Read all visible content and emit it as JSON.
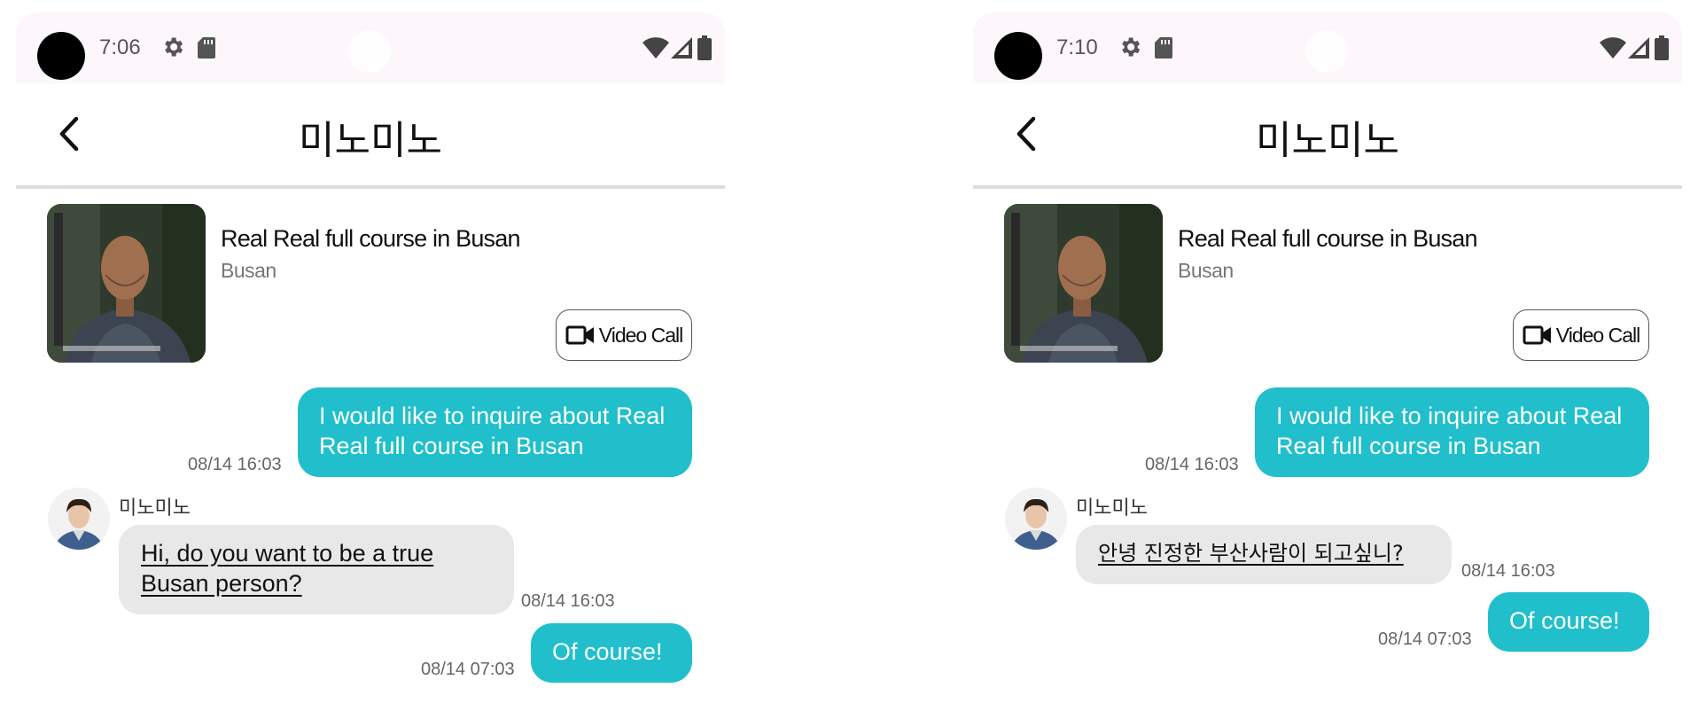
{
  "screens": [
    {
      "status": {
        "time": "7:06"
      },
      "header": {
        "title": "미노미노"
      },
      "product": {
        "title": "Real Real full course in Busan",
        "location": "Busan",
        "video_call_label": "Video Call"
      },
      "messages": [
        {
          "direction": "out",
          "text": "I would like to inquire about Real Real full course in Busan",
          "time": "08/14 16:03"
        },
        {
          "direction": "in",
          "sender": "미노미노",
          "text": "Hi, do you want to be a true Busan person?",
          "time": "08/14 16:03"
        },
        {
          "direction": "out",
          "text": "Of course!",
          "time": "08/14 07:03"
        }
      ]
    },
    {
      "status": {
        "time": "7:10"
      },
      "header": {
        "title": "미노미노"
      },
      "product": {
        "title": "Real Real full course in Busan",
        "location": "Busan",
        "video_call_label": "Video Call"
      },
      "messages": [
        {
          "direction": "out",
          "text": "I would like to inquire about Real Real full course in Busan",
          "time": "08/14 16:03"
        },
        {
          "direction": "in",
          "sender": "미노미노",
          "text": "안녕 진정한 부산사람이 되고싶니?",
          "time": "08/14 16:03"
        },
        {
          "direction": "out",
          "text": "Of course!",
          "time": "08/14 07:03"
        }
      ]
    }
  ],
  "colors": {
    "accent": "#20bfcb",
    "incoming_bubble": "#e8e8e8",
    "status_bar": "#fdf7fc"
  },
  "icons": [
    "camera-dot",
    "gear-icon",
    "sd-card-icon",
    "wifi-icon",
    "signal-icon",
    "battery-icon",
    "back-arrow-icon",
    "video-camera-icon"
  ]
}
